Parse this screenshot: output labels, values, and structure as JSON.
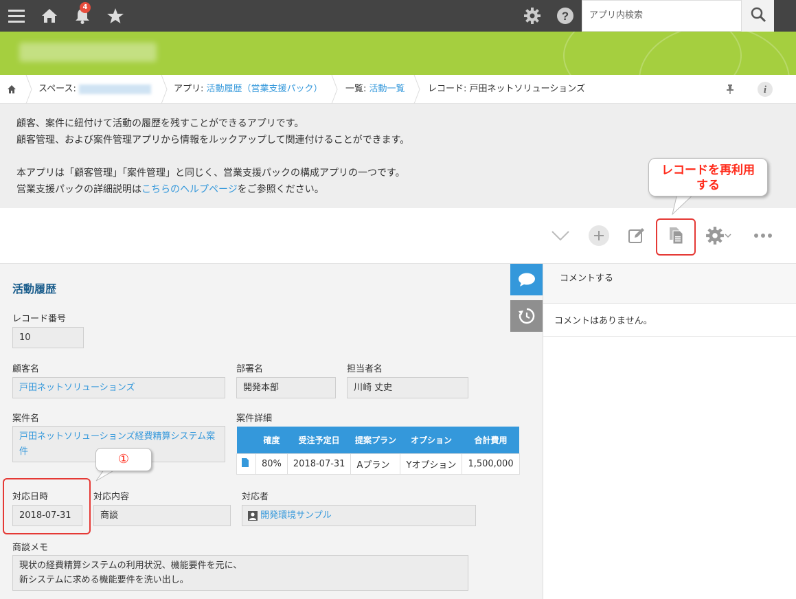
{
  "topbar": {
    "notification_count": "4",
    "search_placeholder": "アプリ内検索",
    "icons": [
      "menu-icon",
      "home-icon",
      "bell-icon",
      "star-icon",
      "gear-icon",
      "help-icon",
      "search-icon"
    ]
  },
  "breadcrumb": {
    "space_label": "スペース:",
    "app_prefix": "アプリ:",
    "app_name": "活動履歴（営業支援パック）",
    "list_prefix": "一覧:",
    "list_name": "活動一覧",
    "record_prefix": "レコード:",
    "record_name": "戸田ネットソリューションズ"
  },
  "description": {
    "line1": "顧客、案件に紐付けて活動の履歴を残すことができるアプリです。",
    "line2": "顧客管理、および案件管理アプリから情報をルックアップして関連付けることができます。",
    "line3": "本アプリは「顧客管理」「案件管理」と同じく、営業支援パックの構成アプリの一つです。",
    "line4_before": "営業支援パックの詳細説明は",
    "line4_link": "こちらのヘルプページ",
    "line4_after": "をご参照ください。"
  },
  "annotations": {
    "reuse_callout_line1": "レコードを再利用",
    "reuse_callout_line2": "する",
    "step_marker": "①"
  },
  "record": {
    "title": "活動履歴",
    "record_no_label": "レコード番号",
    "record_no": "10",
    "customer_label": "顧客名",
    "customer": "戸田ネットソリューションズ",
    "dept_label": "部署名",
    "dept": "開発本部",
    "person_label": "担当者名",
    "person": "川崎 丈史",
    "deal_label": "案件名",
    "deal": "戸田ネットソリューションズ経費精算システム案件",
    "deal_detail_label": "案件詳細",
    "table_headers": [
      "確度",
      "受注予定日",
      "提案プラン",
      "オプション",
      "合計費用"
    ],
    "table_row": [
      "80%",
      "2018-07-31",
      "Aプラン",
      "Yオプション",
      "1,500,000"
    ],
    "date_label": "対応日時",
    "date": "2018-07-31",
    "content_label": "対応内容",
    "content": "商談",
    "handler_label": "対応者",
    "handler": "開発環境サンプル",
    "memo_label": "商談メモ",
    "memo_line1": "現状の経費精算システムの利用状況、機能要件を元に、",
    "memo_line2": "新システムに求める機能要件を洗い出し。"
  },
  "comments": {
    "input_placeholder": "コメントする",
    "empty_text": "コメントはありません。"
  },
  "colors": {
    "topbar": "#444444",
    "banner": "#a5cf3f",
    "link": "#3498db",
    "table_header": "#3498db",
    "highlight": "#e53935"
  }
}
